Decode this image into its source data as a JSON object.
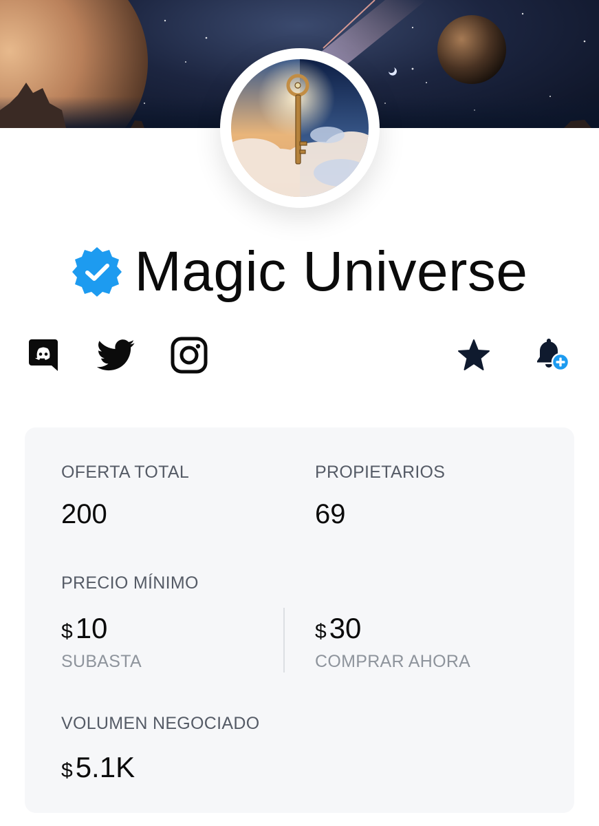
{
  "collection": {
    "name": "Magic Universe",
    "verified_icon": "verified-badge-icon",
    "accent": "#1d9bf0"
  },
  "social": [
    {
      "name": "discord",
      "icon": "discord-icon"
    },
    {
      "name": "twitter",
      "icon": "twitter-icon"
    },
    {
      "name": "instagram",
      "icon": "instagram-icon"
    }
  ],
  "actions": [
    {
      "name": "favorite",
      "icon": "star-icon"
    },
    {
      "name": "notify",
      "icon": "bell-plus-icon"
    }
  ],
  "stats": {
    "total_supply_label": "OFERTA TOTAL",
    "total_supply_value": "200",
    "owners_label": "PROPIETARIOS",
    "owners_value": "69",
    "floor_label": "PRECIO MÍNIMO",
    "currency": "$",
    "auction_value": "10",
    "auction_label": "SUBASTA",
    "buy_now_value": "30",
    "buy_now_label": "COMPRAR AHORA",
    "volume_label": "VOLUMEN NEGOCIADO",
    "volume_value": "5.1K"
  }
}
